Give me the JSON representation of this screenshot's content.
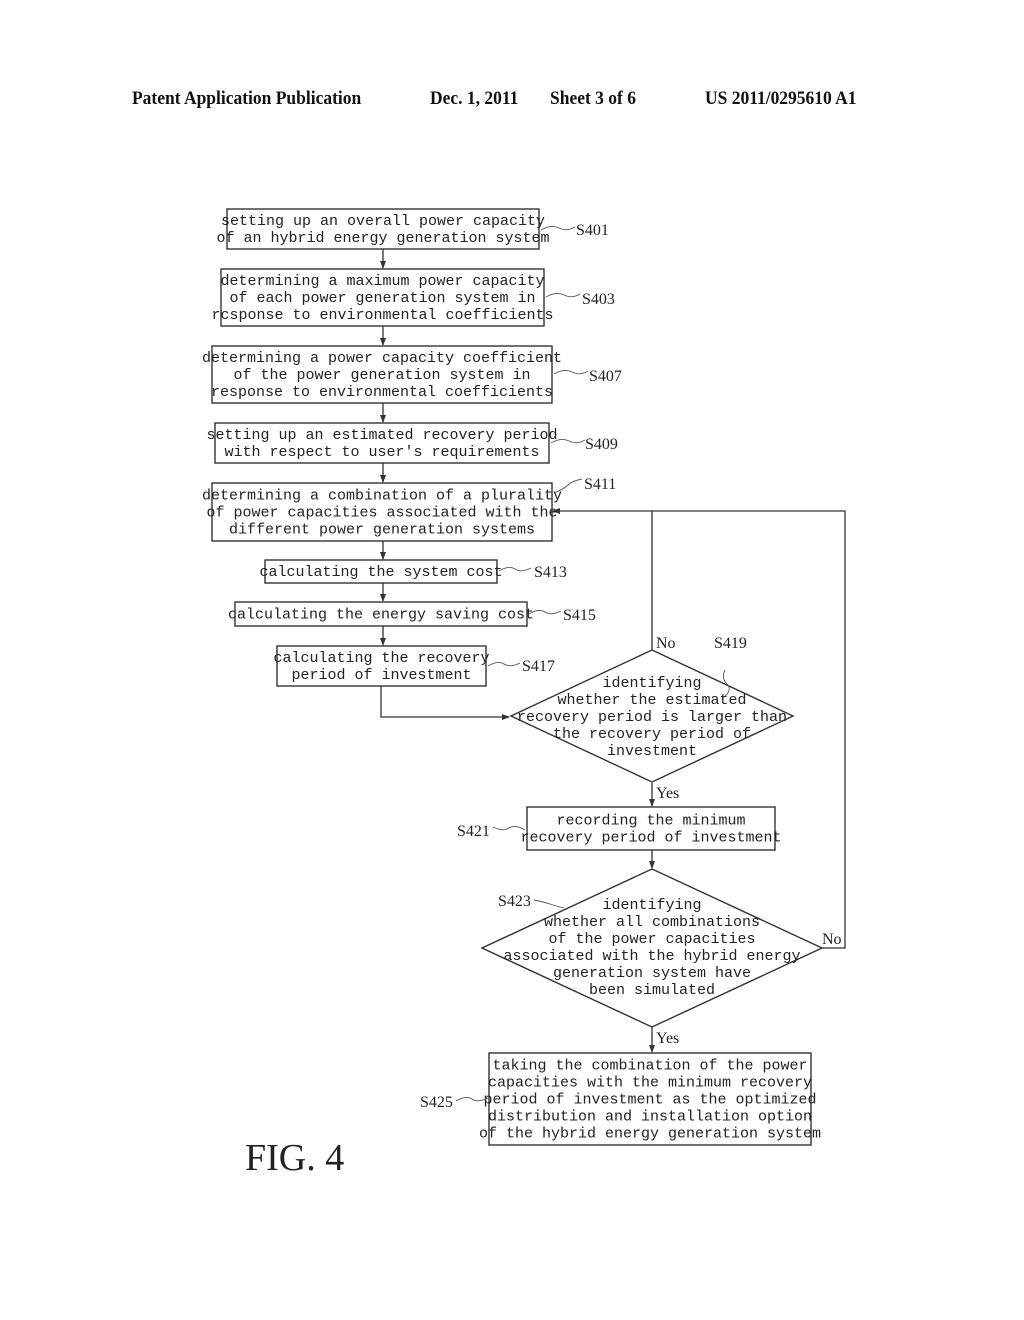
{
  "header": {
    "title": "Patent Application Publication",
    "date": "Dec. 1, 2011",
    "sheet": "Sheet 3 of 6",
    "publication_number": "US 2011/0295610 A1"
  },
  "figure_label": "FIG. 4",
  "steps": [
    {
      "id": "S401",
      "lines": [
        "setting up an overall power capacity",
        "of an hybrid energy generation system"
      ]
    },
    {
      "id": "S403",
      "lines": [
        "determining a maximum power capacity",
        "of each power generation system in",
        "rcsponse to environmental coefficients"
      ]
    },
    {
      "id": "S407",
      "lines": [
        "determining a power capacity coefficient",
        "of the power generation system in",
        "response to environmental coefficients"
      ]
    },
    {
      "id": "S409",
      "lines": [
        "setting up an estimated recovery period",
        "with respect to user's requirements"
      ]
    },
    {
      "id": "S411",
      "lines": [
        "determining a combination of a plurality",
        "of power capacities associated with the",
        "different power generation systems"
      ]
    },
    {
      "id": "S413",
      "lines": [
        "calculating the system cost"
      ]
    },
    {
      "id": "S415",
      "lines": [
        "calculating the energy saving cost"
      ]
    },
    {
      "id": "S417",
      "lines": [
        "calculating the recovery",
        "period of investment"
      ]
    },
    {
      "id": "S419",
      "lines": [
        "identifying",
        "whether the estimated",
        "recovery period is larger than",
        "the recovery period of",
        "investment"
      ]
    },
    {
      "id": "S421",
      "lines": [
        "recording the minimum",
        "recovery period of investment"
      ]
    },
    {
      "id": "S423",
      "lines": [
        "identifying",
        "whether all combinations",
        "of the power capacities",
        "associated with the hybrid energy",
        "generation system have",
        "been simulated"
      ]
    },
    {
      "id": "S425",
      "lines": [
        "taking the combination of the power",
        "capacities with the minimum recovery",
        "period of investment as the optimized",
        "distribution and installation option",
        "of the hybrid energy generation system"
      ]
    }
  ],
  "branch_labels": {
    "s419_no": "No",
    "s419_yes": "Yes",
    "s423_no": "No",
    "s423_yes": "Yes"
  }
}
